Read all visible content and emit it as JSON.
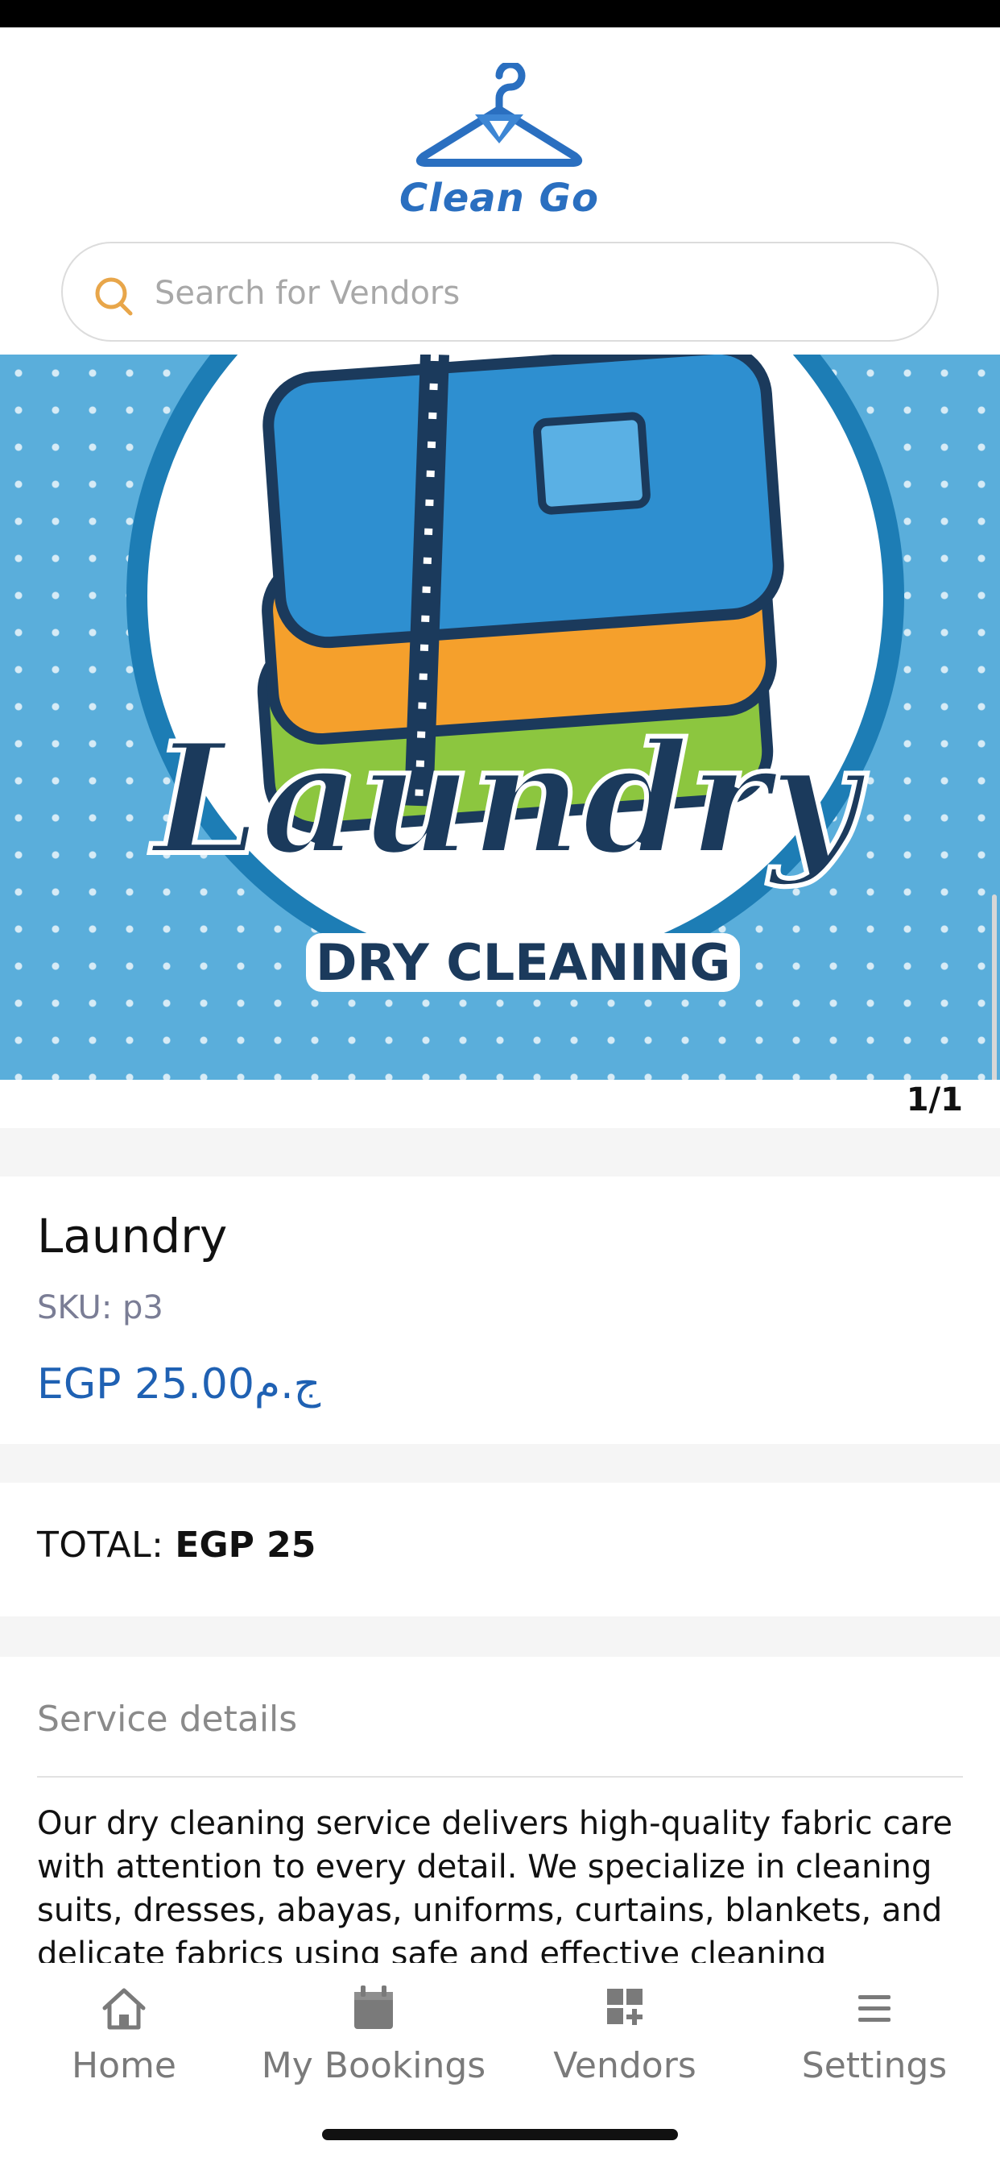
{
  "app": {
    "brand_name": "Clean Go",
    "search_placeholder": "Search for Vendors"
  },
  "banner": {
    "script_title": "Laundry",
    "subtitle": "DRY CLEANING",
    "pager": "1/1"
  },
  "product": {
    "title": "Laundry",
    "sku": "SKU: p3",
    "price": "EGP 25.00ج.م"
  },
  "total": {
    "label": "TOTAL:",
    "value": "EGP 25"
  },
  "details": {
    "title": "Service details",
    "text": "Our dry cleaning service delivers high-quality fabric care with attention to every detail. We specialize in cleaning suits, dresses, abayas, uniforms, curtains, blankets, and delicate fabrics using safe and effective cleaning"
  },
  "tabs": [
    {
      "label": "Home",
      "icon": "home-icon"
    },
    {
      "label": "My Bookings",
      "icon": "calendar-icon"
    },
    {
      "label": "Vendors",
      "icon": "grid-plus-icon"
    },
    {
      "label": "Settings",
      "icon": "menu-icon"
    }
  ],
  "colors": {
    "brand_blue": "#2a6fc0",
    "price_blue": "#1f61b3",
    "banner_bg": "#5aaedb",
    "search_icon": "#e8a64a"
  }
}
